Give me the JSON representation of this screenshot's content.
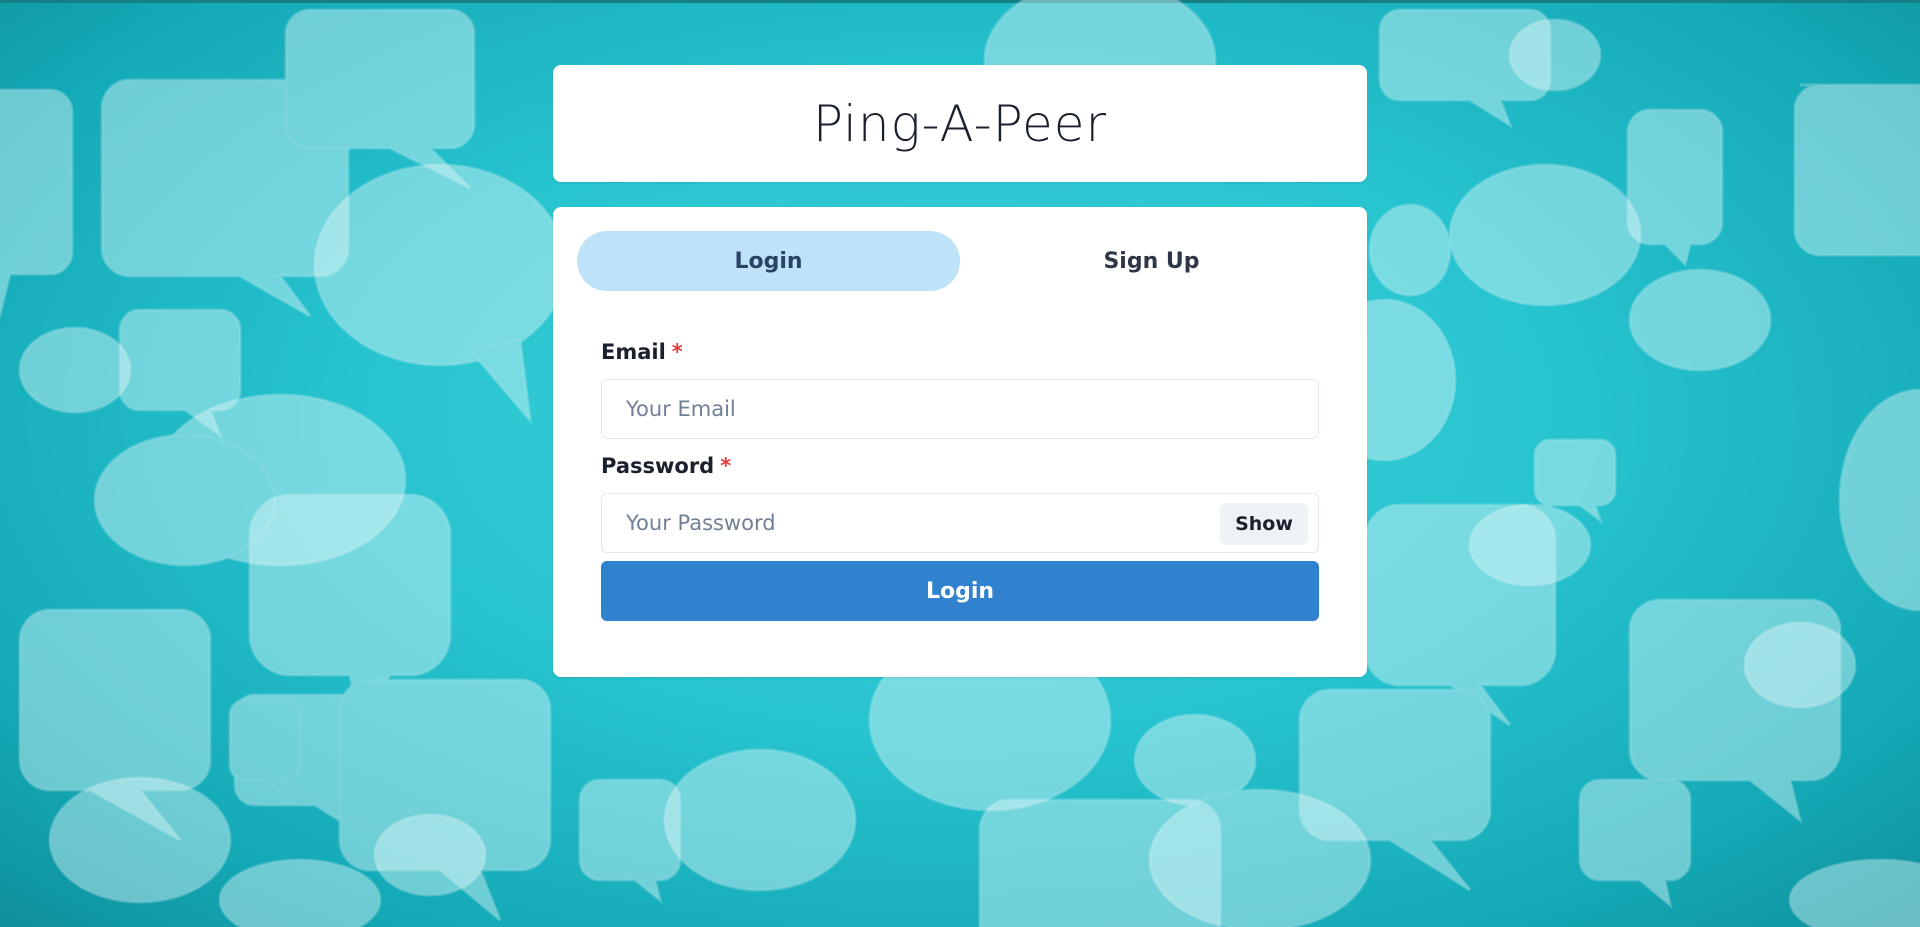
{
  "app": {
    "title": "Ping-A-Peer"
  },
  "tabs": [
    {
      "label": "Login",
      "active": true
    },
    {
      "label": "Sign Up",
      "active": false
    }
  ],
  "form": {
    "email": {
      "label": "Email",
      "required_mark": "*",
      "placeholder": "Your Email",
      "value": ""
    },
    "password": {
      "label": "Password",
      "required_mark": "*",
      "placeholder": "Your Password",
      "value": "",
      "toggle_label": "Show"
    },
    "submit_label": "Login"
  },
  "colors": {
    "background": "#27c3cf",
    "active_tab": "#bee3f8",
    "primary_button": "#3182ce",
    "required": "#e53e3e"
  },
  "icons": {
    "background_pattern": "speech-bubble-icon"
  }
}
